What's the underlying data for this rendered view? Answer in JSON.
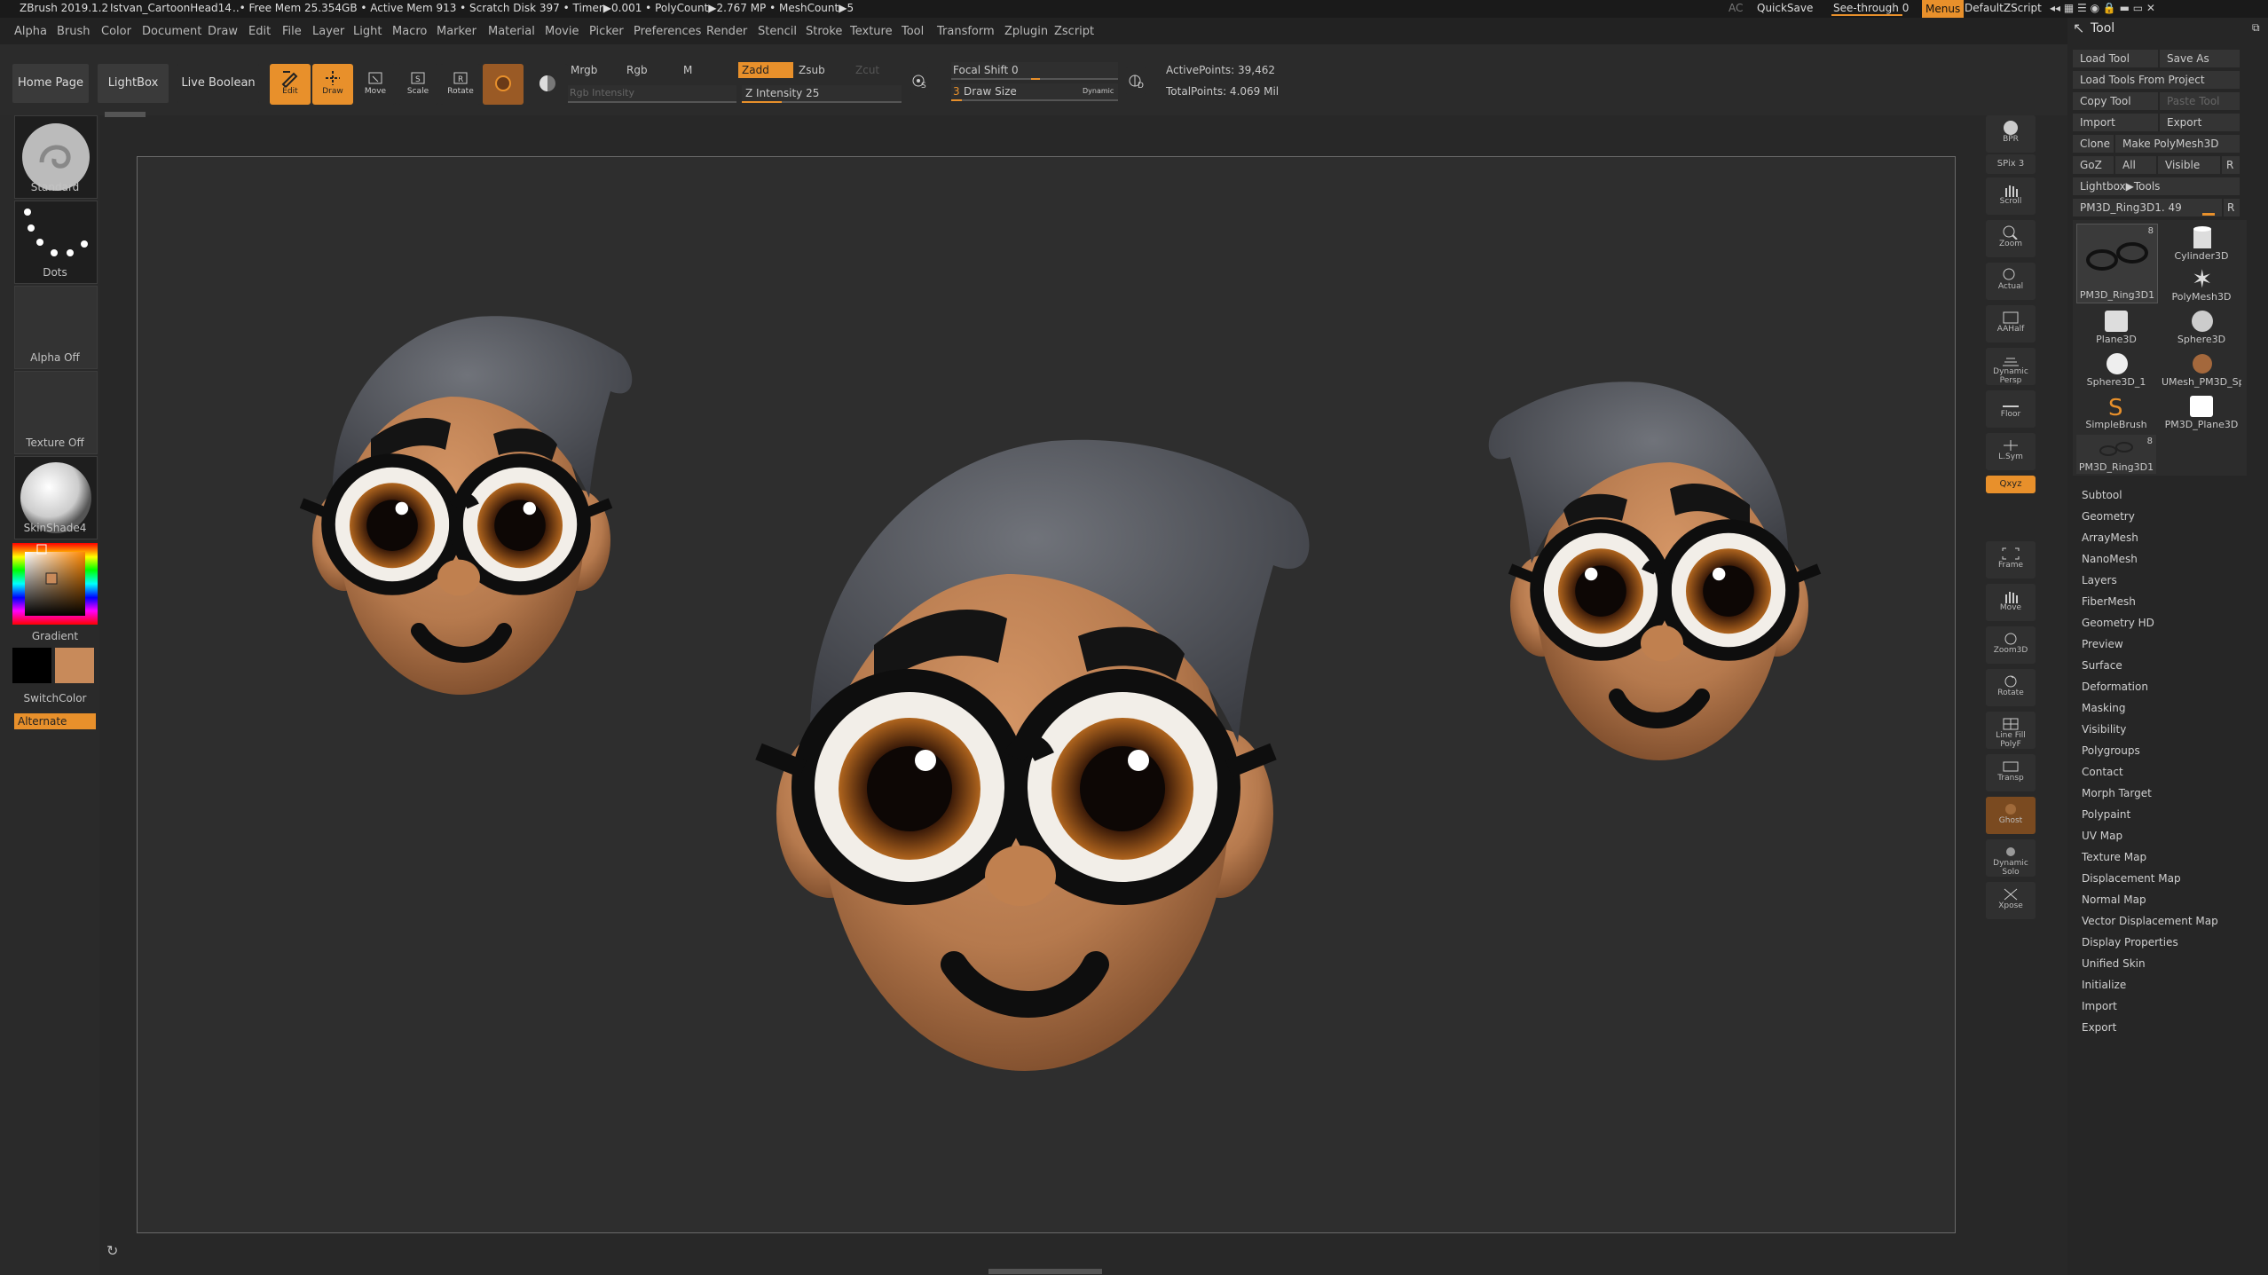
{
  "titlebar": {
    "app": "ZBrush 2019.1.2",
    "doc": "Istvan_CartoonHead14",
    "stats": "..• Free Mem 25.354GB • Active Mem 913 • Scratch Disk 397 • Timer▶0.001 • PolyCount▶2.767 MP • MeshCount▶5",
    "ac": "AC",
    "quicksave": "QuickSave",
    "seethrough": "See-through",
    "seethrough_value": "0",
    "menus": "Menus",
    "script": "DefaultZScript"
  },
  "menu": [
    "Alpha",
    "Brush",
    "Color",
    "Document",
    "Draw",
    "Edit",
    "File",
    "Layer",
    "Light",
    "Macro",
    "Marker",
    "Material",
    "Movie",
    "Picker",
    "Preferences",
    "Render",
    "Stencil",
    "Stroke",
    "Texture",
    "Tool",
    "Transform",
    "Zplugin",
    "Zscript"
  ],
  "shelf": {
    "home": "Home Page",
    "lightbox": "LightBox",
    "liveboolean": "Live Boolean",
    "edit": "Edit",
    "draw": "Draw",
    "move": "Move",
    "scale": "Scale",
    "rotate": "Rotate",
    "mrgb": "Mrgb",
    "rgb": "Rgb",
    "m": "M",
    "rgb_intensity": "Rgb Intensity",
    "zadd": "Zadd",
    "zsub": "Zsub",
    "zcut": "Zcut",
    "z_intensity": "Z Intensity 25",
    "z_intensity_value": 25,
    "focal_shift": "Focal Shift 0",
    "draw_size": "Draw Size",
    "draw_size_value": "3",
    "dynamic": "Dynamic",
    "active_points": "ActivePoints: 39,462",
    "total_points": "TotalPoints: 4.069 Mil",
    "s": "S",
    "d": "D"
  },
  "lefttray": {
    "brush": "Standard",
    "stroke": "Dots",
    "alpha": "Alpha Off",
    "texture": "Texture Off",
    "material": "SkinShade4",
    "gradient": "Gradient",
    "switchcolor": "SwitchColor",
    "alternate": "Alternate",
    "main_color": "#000000",
    "secondary_color": "#c88a5a"
  },
  "rightnav": [
    "BPR",
    "SPix 3",
    "Scroll",
    "Zoom",
    "Actual",
    "AAHalf",
    "Dynamic Persp",
    "Floor",
    "L.Sym",
    "Qxyz",
    "Frame",
    "Move",
    "Zoom3D",
    "Rotate",
    "Line Fill PolyF",
    "Transp",
    "Ghost",
    "Dynamic Solo",
    "Xpose"
  ],
  "toolpanel": {
    "title": "Tool",
    "load_tool": "Load Tool",
    "save_as": "Save As",
    "load_from_project": "Load Tools From Project",
    "copy_tool": "Copy Tool",
    "paste_tool": "Paste Tool",
    "import": "Import",
    "export": "Export",
    "clone": "Clone",
    "make_polymesh": "Make PolyMesh3D",
    "goz": "GoZ",
    "all": "All",
    "visible": "Visible",
    "r": "R",
    "lightbox_tools": "Lightbox▶Tools",
    "current_tool": "PM3D_Ring3D1. 49",
    "tools": [
      {
        "name": "PM3D_Ring3D1",
        "badge": "8"
      },
      {
        "name": "Cylinder3D",
        "badge": ""
      },
      {
        "name": "PolyMesh3D",
        "badge": ""
      },
      {
        "name": "Plane3D",
        "badge": ""
      },
      {
        "name": "Sphere3D",
        "badge": ""
      },
      {
        "name": "Sphere3D_1",
        "badge": ""
      },
      {
        "name": "UMesh_PM3D_Sp",
        "badge": ""
      },
      {
        "name": "SimpleBrush",
        "badge": ""
      },
      {
        "name": "PM3D_Plane3D",
        "badge": ""
      },
      {
        "name": "PM3D_Ring3D1",
        "badge": "8"
      }
    ],
    "subpalettes": [
      "Subtool",
      "Geometry",
      "ArrayMesh",
      "NanoMesh",
      "Layers",
      "FiberMesh",
      "Geometry HD",
      "Preview",
      "Surface",
      "Deformation",
      "Masking",
      "Visibility",
      "Polygroups",
      "Contact",
      "Morph Target",
      "Polypaint",
      "UV Map",
      "Texture Map",
      "Displacement Map",
      "Normal Map",
      "Vector Displacement Map",
      "Display Properties",
      "Unified Skin",
      "Initialize",
      "Import",
      "Export"
    ]
  },
  "colors": {
    "accent": "#e8902b",
    "skin": "#b5794d",
    "hair": "#54575e",
    "glasses": "#111111"
  }
}
